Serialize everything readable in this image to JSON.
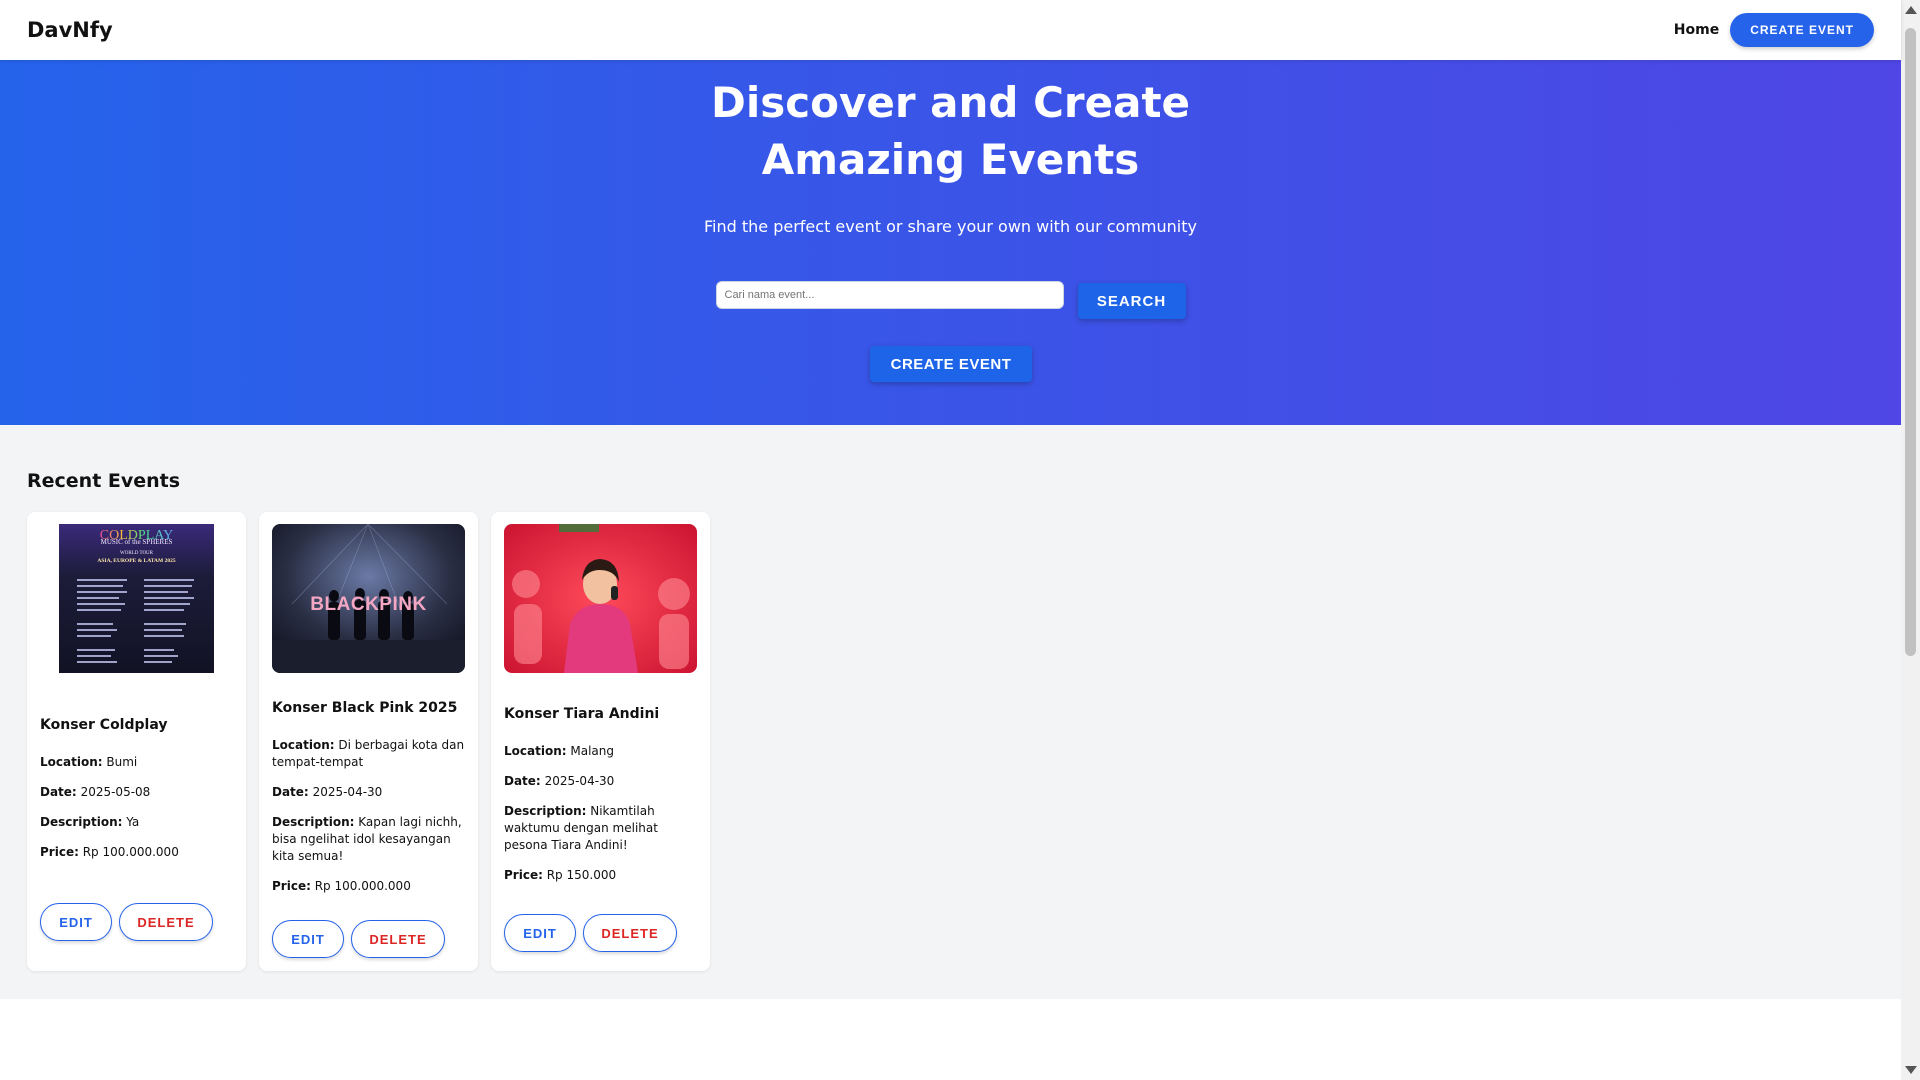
{
  "navbar": {
    "brand": "DavNfy",
    "home_label": "Home",
    "create_label": "CREATE EVENT"
  },
  "hero": {
    "title": "Discover and Create Amazing Events",
    "subtitle": "Find the perfect event or share your own with our community",
    "search_placeholder": "Cari nama event...",
    "search_label": "SEARCH",
    "create_label": "CREATE EVENT"
  },
  "recent": {
    "title": "Recent Events",
    "labels": {
      "location": "Location:",
      "date": "Date:",
      "description": "Description:",
      "price": "Price:",
      "edit": "EDIT",
      "delete": "DELETE"
    },
    "events": [
      {
        "title": "Konser Coldplay",
        "location": "Bumi",
        "date": "2025-05-08",
        "description": "Ya",
        "price": "Rp 100.000.000",
        "image": {
          "heading": "COLDPLAY",
          "sub": "MUSIC of the SPHERES",
          "tour": "WORLD TOUR",
          "region": "ASIA, EUROPE & LATAM 2025"
        }
      },
      {
        "title": "Konser Black Pink 2025",
        "location": "Di berbagai kota dan tempat-tempat",
        "date": "2025-04-30",
        "description": "Kapan lagi nichh, bisa ngelihat idol kesayangan kita semua!",
        "price": "Rp 100.000.000",
        "image": {
          "heading": "BLACKPINK"
        }
      },
      {
        "title": "Konser Tiara Andini",
        "location": "Malang",
        "date": "2025-04-30",
        "description": "Nikamtilah waktumu dengan melihat pesona Tiara Andini!",
        "price": "Rp 150.000"
      }
    ]
  },
  "colors": {
    "primary": "#2563eb",
    "hero_end": "#4f46e5",
    "danger": "#dc2626",
    "content_bg": "#f3f4f6"
  }
}
